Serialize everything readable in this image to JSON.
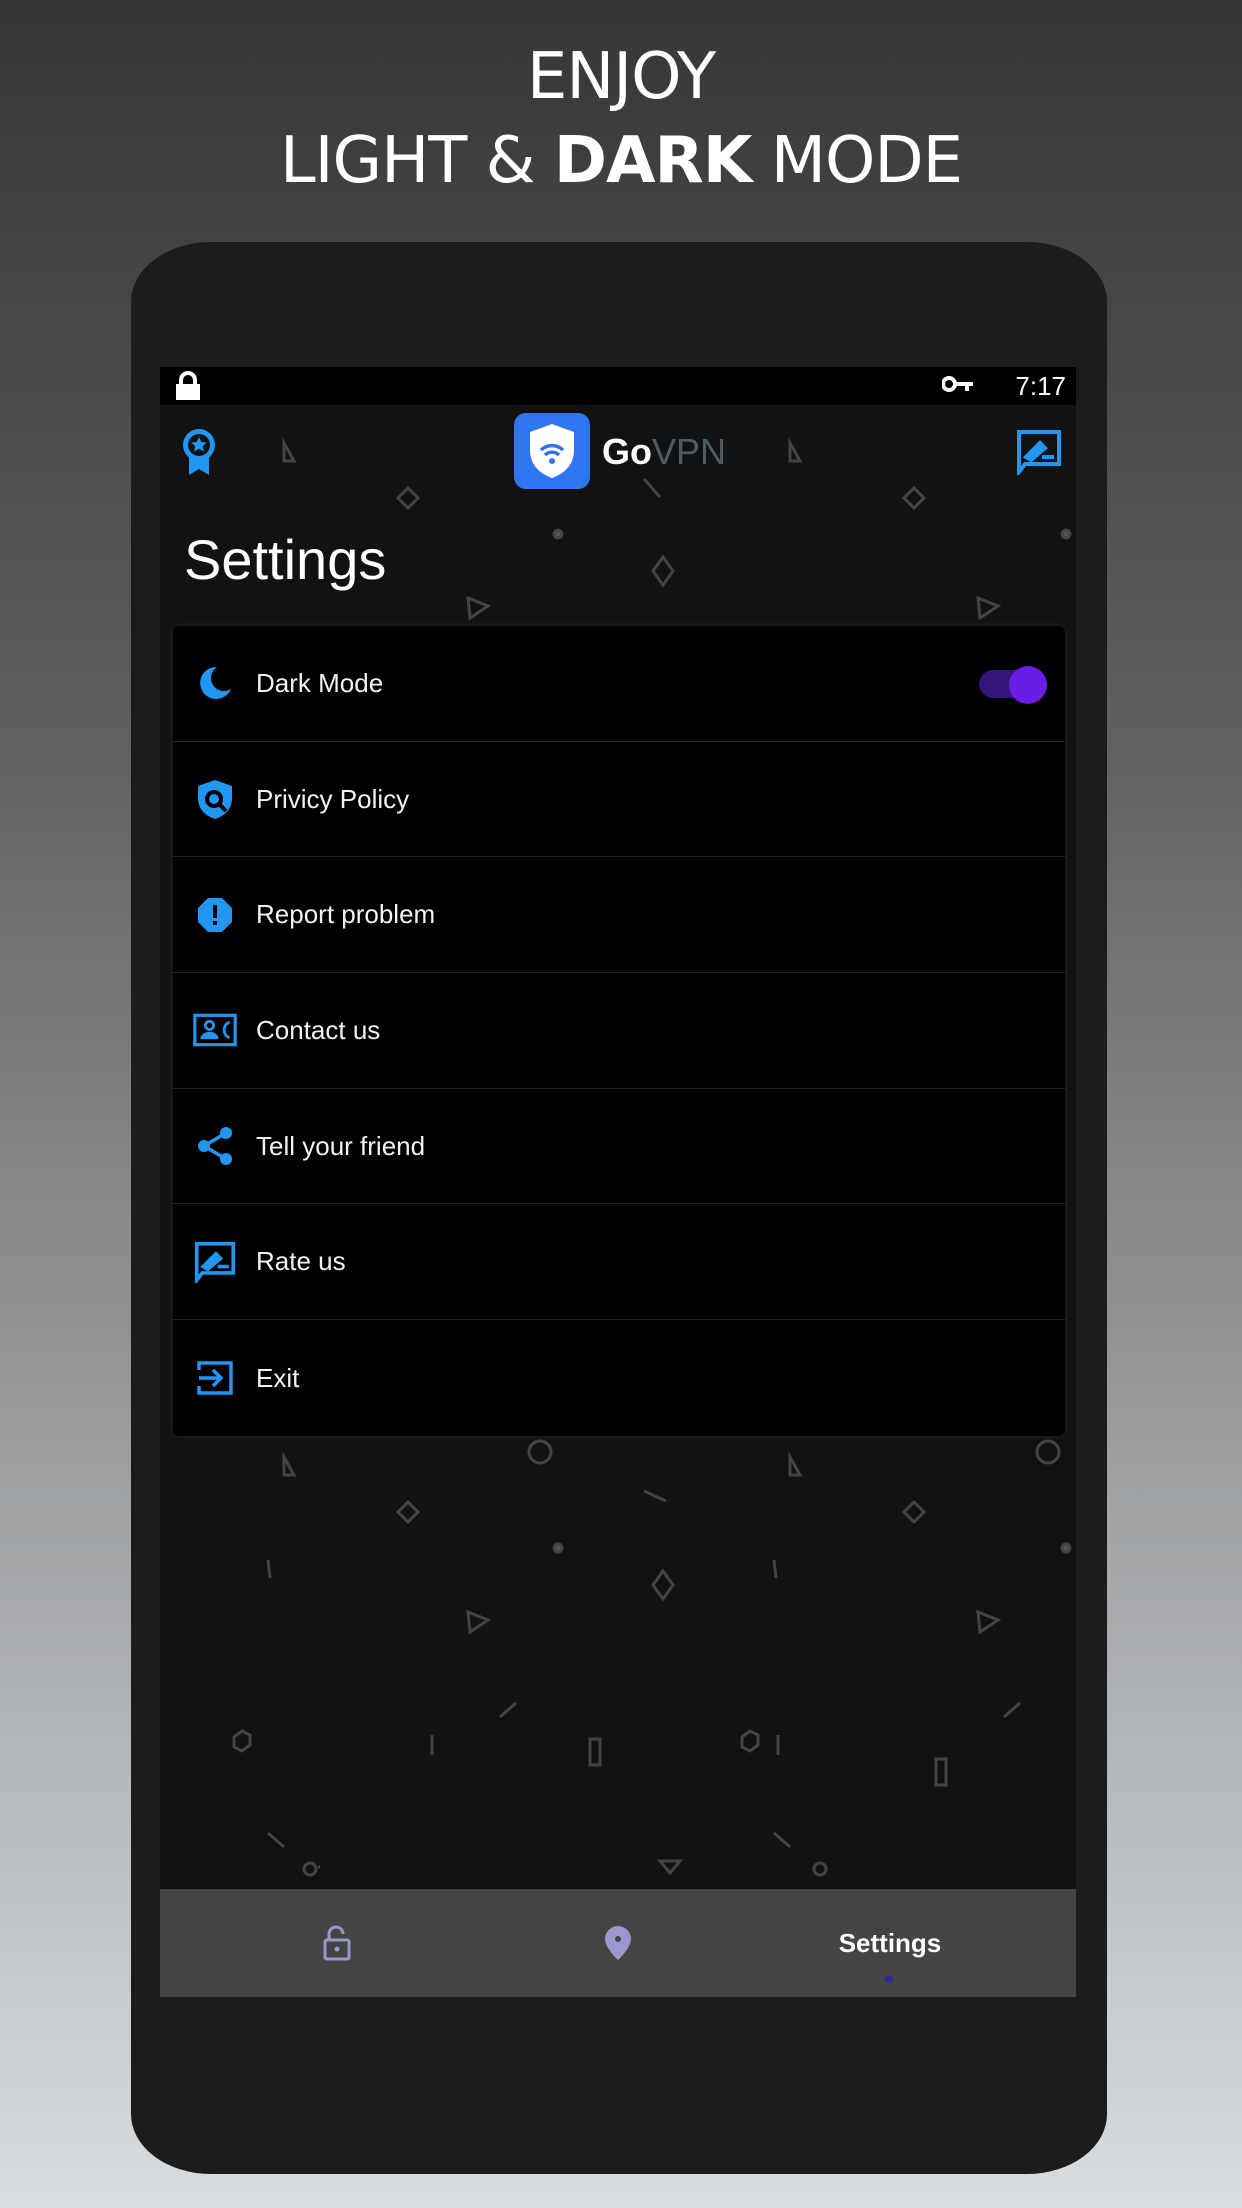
{
  "promo": {
    "line1": "ENJOY",
    "line2_prefix": "LIGHT & ",
    "line2_bold": "DARK",
    "line2_suffix": " MODE"
  },
  "status_bar": {
    "time": "7:17",
    "icons": [
      "lock-icon",
      "vpn-key-icon"
    ]
  },
  "header": {
    "brand_bold": "Go",
    "brand_light": "VPN",
    "left_icon": "award-badge-icon",
    "right_icon": "rate-feedback-icon"
  },
  "page_title": "Settings",
  "settings": {
    "items": [
      {
        "label": "Dark Mode",
        "icon": "moon-icon",
        "toggle": true
      },
      {
        "label": "Privicy Policy",
        "icon": "shield-search-icon"
      },
      {
        "label": "Report problem",
        "icon": "alert-octagon-icon"
      },
      {
        "label": "Contact us",
        "icon": "contact-card-icon"
      },
      {
        "label": "Tell your friend",
        "icon": "share-icon"
      },
      {
        "label": "Rate us",
        "icon": "rate-feedback-icon"
      },
      {
        "label": "Exit",
        "icon": "exit-icon"
      }
    ]
  },
  "bottom_nav": {
    "items": [
      {
        "icon": "unlock-icon"
      },
      {
        "icon": "location-pin-icon"
      },
      {
        "label": "Settings",
        "active": true
      }
    ]
  },
  "colors": {
    "accent": "#2196F3",
    "toggle_on": "#6a1de6",
    "nav_icon": "#9a98cc"
  }
}
